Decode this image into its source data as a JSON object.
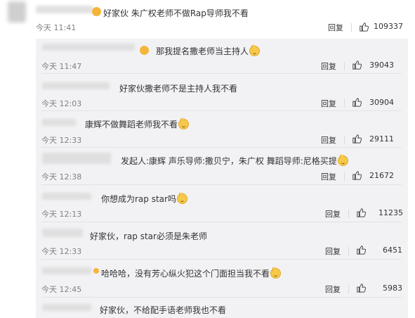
{
  "main_comment": {
    "text": "好家伙 朱广权老师不做Rap导师我不看",
    "time": "今天 11:41",
    "reply_label": "回复",
    "likes": "109337"
  },
  "replies": [
    {
      "text": "那我提名撒老师当主持人",
      "time": "今天 11:47",
      "reply_label": "回复",
      "likes": "39043"
    },
    {
      "text": "好家伙撒老师不是主持人我不看",
      "time": "今天 12:03",
      "reply_label": "回复",
      "likes": "30904"
    },
    {
      "text": "康辉不做舞蹈老师我不看",
      "time": "今天 12:33",
      "reply_label": "回复",
      "likes": "29111"
    },
    {
      "text": "发起人:康辉 声乐导师:撒贝宁，朱广权 舞蹈导师:尼格买提",
      "time": "今天 12:38",
      "reply_label": "回复",
      "likes": "21672"
    },
    {
      "text": "你想成为rap star吗",
      "time": "今天 12:13",
      "reply_label": "回复",
      "likes": "11235"
    },
    {
      "text": "好家伙，rap star必须是朱老师",
      "time": "今天 12:33",
      "reply_label": "回复",
      "likes": "6451"
    },
    {
      "text": "哈哈哈，没有芳心纵火犯这个门面担当我不看",
      "time": "今天 12:45",
      "reply_label": "回复",
      "likes": "5983"
    },
    {
      "text": "好家伙，不给配手语老师我也不看"
    }
  ],
  "icons": {
    "like": "thumbs-up-icon",
    "emoji": "doge-emoji-icon"
  },
  "colors": {
    "panel_bg": "#f2f2f5",
    "text": "#333333",
    "time": "#808080"
  }
}
